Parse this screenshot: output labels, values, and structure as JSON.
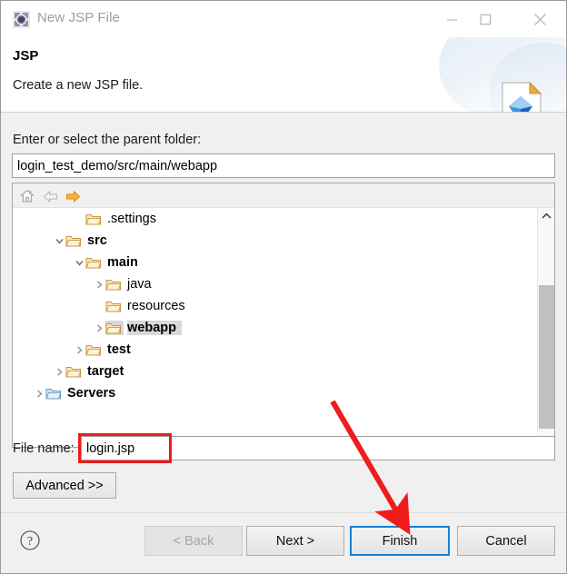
{
  "window": {
    "title": "New JSP File",
    "icon": "eclipse-jsp-icon",
    "minimize_label": "—",
    "maximize_label": "□",
    "close_label": "✕"
  },
  "header": {
    "title": "JSP",
    "description": "Create a new JSP file.",
    "icon": "jsp-file-page-icon"
  },
  "parent_folder": {
    "label": "Enter or select the parent folder:",
    "value": "login_test_demo/src/main/webapp",
    "placeholder": ""
  },
  "tree_toolbar": {
    "home_icon": "home-icon",
    "back_icon": "back-arrow-icon",
    "forward_icon": "forward-arrow-icon"
  },
  "tree": {
    "nodes": [
      {
        "label": ".settings",
        "indent": 2,
        "twisty": "",
        "icon": "folder-icon",
        "selected": false,
        "bold": false
      },
      {
        "label": "src",
        "indent": 1,
        "twisty": "v",
        "icon": "folder-icon",
        "selected": false,
        "bold": true
      },
      {
        "label": "main",
        "indent": 2,
        "twisty": "v",
        "icon": "folder-icon",
        "selected": false,
        "bold": true
      },
      {
        "label": "java",
        "indent": 3,
        "twisty": ">",
        "icon": "folder-icon",
        "selected": false,
        "bold": false
      },
      {
        "label": "resources",
        "indent": 3,
        "twisty": "",
        "icon": "folder-icon",
        "selected": false,
        "bold": false
      },
      {
        "label": "webapp",
        "indent": 3,
        "twisty": ">",
        "icon": "folder-icon",
        "selected": true,
        "bold": true
      },
      {
        "label": "test",
        "indent": 2,
        "twisty": ">",
        "icon": "folder-icon",
        "selected": false,
        "bold": true
      },
      {
        "label": "target",
        "indent": 1,
        "twisty": ">",
        "icon": "folder-icon",
        "selected": false,
        "bold": true
      },
      {
        "label": "Servers",
        "indent": 0,
        "twisty": ">",
        "icon": "server-folder-icon",
        "selected": false,
        "bold": true
      }
    ]
  },
  "scrollbar": {
    "up_icon": "chevron-up-icon",
    "down_icon": "chevron-down-icon"
  },
  "file_name": {
    "label": "File name:",
    "value": "login.jsp",
    "placeholder": ""
  },
  "advanced": {
    "label": "Advanced >>"
  },
  "footer": {
    "help_icon": "help-question-icon",
    "back_label": "< Back",
    "next_label": "Next >",
    "finish_label": "Finish",
    "cancel_label": "Cancel"
  },
  "annotations": {
    "highlight_color": "#ef1a1a",
    "arrow_color": "#f01c1c",
    "focus_color": "#1581d6",
    "selection_color": "#d8d8d8"
  }
}
